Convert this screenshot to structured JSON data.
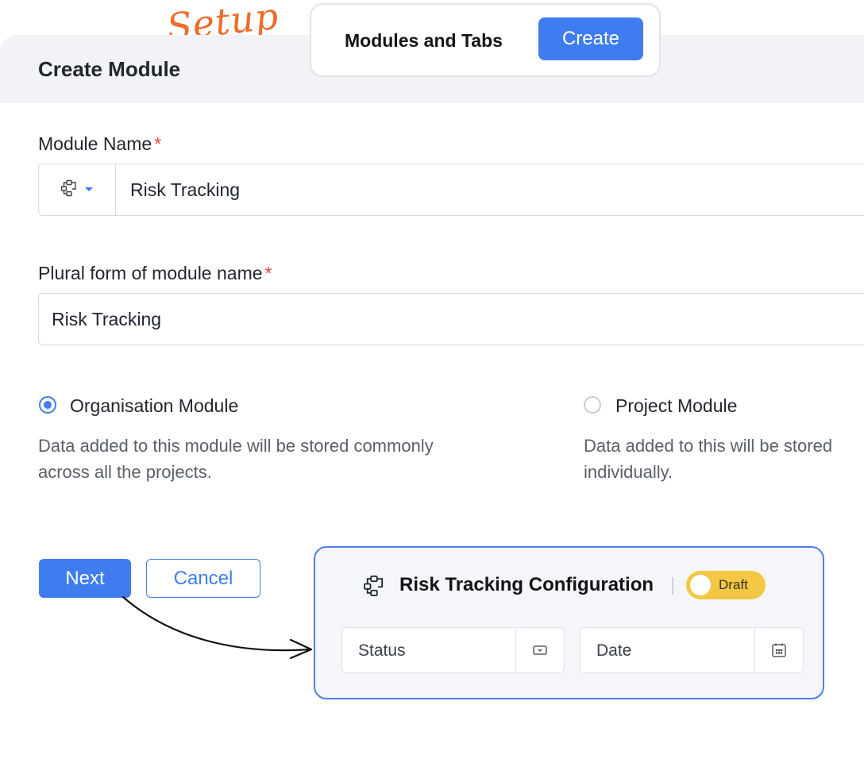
{
  "tag": {
    "text": "Setup"
  },
  "header": {
    "title": "Create Module"
  },
  "modules_card": {
    "label": "Modules and Tabs",
    "create_label": "Create"
  },
  "form": {
    "module_name": {
      "label": "Module Name",
      "required_mark": "*",
      "value": "Risk Tracking",
      "icon": "module-flow-icon"
    },
    "plural_name": {
      "label": "Plural form of module name",
      "required_mark": "*",
      "value": "Risk Tracking"
    },
    "scope_options": [
      {
        "label": "Organisation Module",
        "selected": true,
        "description_line1": "Data added to this module will be stored commonly",
        "description_line2": "across all the projects."
      },
      {
        "label": "Project Module",
        "selected": false,
        "description_line1": "Data added to this will be stored",
        "description_line2": "individually."
      }
    ]
  },
  "actions": {
    "next_label": "Next",
    "cancel_label": "Cancel"
  },
  "config_card": {
    "title": "Risk Tracking Configuration",
    "status_badge": "Draft",
    "fields": [
      {
        "label": "Status",
        "icon": "dropdown-box-icon"
      },
      {
        "label": "Date",
        "icon": "calendar-icon"
      }
    ]
  },
  "colors": {
    "accent": "#3f7cf0",
    "tag": "#ef6c2c",
    "draft": "#f3c744",
    "required": "#e8453c"
  }
}
